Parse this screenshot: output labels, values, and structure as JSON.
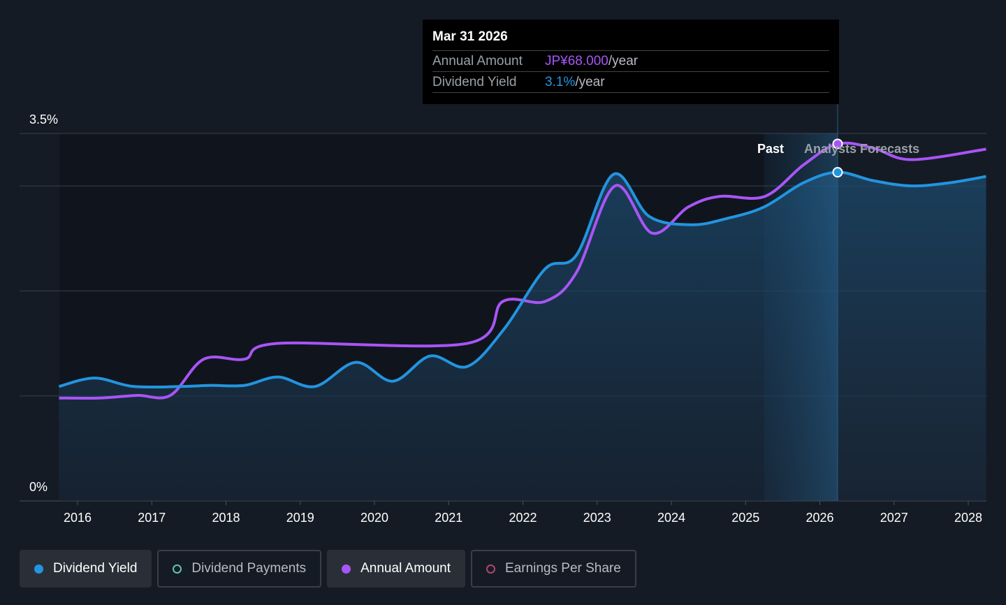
{
  "chart_data": {
    "type": "line",
    "y_tick_labels": [
      "3.5%",
      "0%"
    ],
    "ylim": [
      0,
      3.5
    ],
    "gridlines": [
      1,
      2,
      3,
      3.5
    ],
    "x_tick_labels": [
      "2016",
      "2017",
      "2018",
      "2019",
      "2020",
      "2021",
      "2022",
      "2023",
      "2024",
      "2025",
      "2026",
      "2027",
      "2028"
    ],
    "xlim": [
      2015.75,
      2028.25
    ],
    "past_label": "Past",
    "forecast_label": "Analysts Forecasts",
    "forecast_start": 2026.24,
    "past_band_start": 2025.25,
    "series": [
      {
        "name": "Dividend Yield",
        "unit": "%",
        "color": "#2394df",
        "x": [
          2015.75,
          2016.23,
          2016.75,
          2017.4,
          2017.8,
          2018.25,
          2018.7,
          2019.2,
          2019.75,
          2020.25,
          2020.75,
          2021.25,
          2021.75,
          2022.3,
          2022.72,
          2023.22,
          2023.7,
          2024.27,
          2024.75,
          2025.25,
          2025.78,
          2026.24,
          2026.72,
          2027.23,
          2027.75,
          2028.24
        ],
        "values": [
          1.09,
          1.17,
          1.09,
          1.09,
          1.1,
          1.1,
          1.18,
          1.09,
          1.32,
          1.14,
          1.38,
          1.28,
          1.64,
          2.21,
          2.34,
          3.11,
          2.71,
          2.63,
          2.69,
          2.8,
          3.03,
          3.13,
          3.05,
          3.0,
          3.03,
          3.09
        ]
      },
      {
        "name": "Annual Amount",
        "unit": "JPY",
        "color": "#a855f7",
        "x": [
          2015.75,
          2016.3,
          2016.8,
          2017.25,
          2017.7,
          2018.25,
          2018.7,
          2021.25,
          2021.73,
          2022.3,
          2022.72,
          2023.24,
          2023.74,
          2024.23,
          2024.65,
          2025.26,
          2025.78,
          2026.24,
          2026.72,
          2027.23,
          2028.24
        ],
        "values": [
          19.6,
          19.6,
          20.1,
          20.1,
          27,
          27,
          30,
          30,
          38,
          38,
          43.5,
          60,
          51,
          56,
          58,
          58,
          64,
          68,
          67.2,
          65,
          67
        ]
      }
    ],
    "legend": [
      {
        "label": "Dividend Yield",
        "color": "#2394df",
        "active": true
      },
      {
        "label": "Dividend Payments",
        "color": "#5fc3b0",
        "active": false
      },
      {
        "label": "Annual Amount",
        "color": "#a855f7",
        "active": true
      },
      {
        "label": "Earnings Per Share",
        "color": "#b0456f",
        "active": false
      }
    ]
  },
  "tooltip": {
    "date": "Mar 31 2026",
    "rows": [
      {
        "label": "Annual Amount",
        "value": "JP¥68.000",
        "suffix": "/year",
        "color": "#a855f7"
      },
      {
        "label": "Dividend Yield",
        "value": "3.1%",
        "suffix": "/year",
        "color": "#2394df"
      }
    ]
  }
}
